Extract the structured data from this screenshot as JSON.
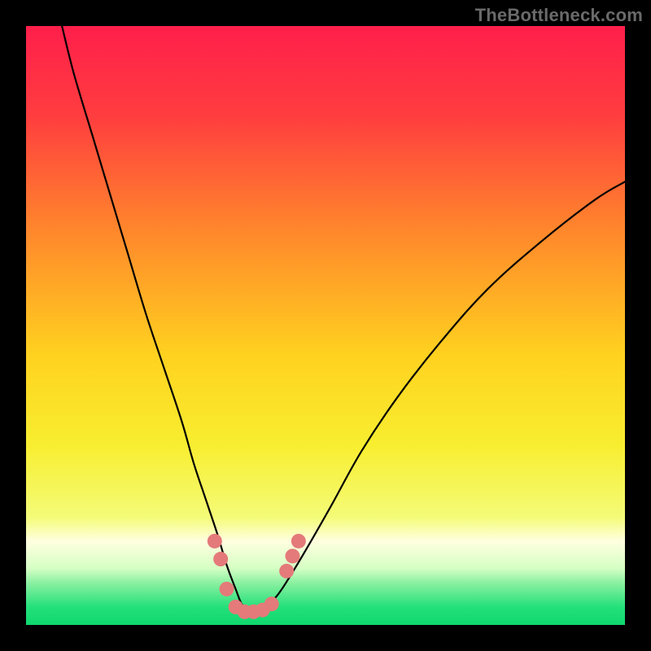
{
  "watermark": "TheBottleneck.com",
  "chart_data": {
    "type": "line",
    "title": "",
    "xlabel": "",
    "ylabel": "",
    "xlim": [
      0,
      100
    ],
    "ylim": [
      0,
      100
    ],
    "background_gradient": {
      "stops": [
        {
          "offset": 0.0,
          "color": "#ff1f4b"
        },
        {
          "offset": 0.15,
          "color": "#ff3d3f"
        },
        {
          "offset": 0.35,
          "color": "#ff8a2b"
        },
        {
          "offset": 0.55,
          "color": "#ffd21f"
        },
        {
          "offset": 0.7,
          "color": "#f8ee30"
        },
        {
          "offset": 0.82,
          "color": "#f4fb77"
        },
        {
          "offset": 0.86,
          "color": "#ffffe0"
        },
        {
          "offset": 0.905,
          "color": "#d6ffc4"
        },
        {
          "offset": 0.93,
          "color": "#8af0a0"
        },
        {
          "offset": 0.97,
          "color": "#24e07a"
        },
        {
          "offset": 1.0,
          "color": "#0fd86e"
        }
      ]
    },
    "series": [
      {
        "name": "bottleneck-curve",
        "x": [
          6,
          8,
          11,
          14,
          17,
          20,
          23,
          26,
          28,
          30,
          32,
          33.5,
          35,
          36,
          37,
          38,
          40,
          42,
          44,
          47,
          51,
          56,
          62,
          69,
          77,
          86,
          95,
          100
        ],
        "y": [
          100,
          92,
          82,
          72,
          62,
          52,
          43,
          34,
          27,
          21,
          15,
          10,
          6,
          3.5,
          2.5,
          2.5,
          3,
          5,
          8,
          13,
          20,
          29,
          38,
          47,
          56,
          64,
          71,
          74
        ]
      }
    ],
    "markers": {
      "name": "highlight-dots",
      "color": "#e47a7a",
      "radius": 9,
      "points": [
        {
          "x": 31.5,
          "y": 14
        },
        {
          "x": 32.5,
          "y": 11
        },
        {
          "x": 33.5,
          "y": 6
        },
        {
          "x": 35.0,
          "y": 3
        },
        {
          "x": 36.5,
          "y": 2.2
        },
        {
          "x": 38.0,
          "y": 2.2
        },
        {
          "x": 39.5,
          "y": 2.5
        },
        {
          "x": 41.0,
          "y": 3.5
        },
        {
          "x": 43.5,
          "y": 9
        },
        {
          "x": 44.5,
          "y": 11.5
        },
        {
          "x": 45.5,
          "y": 14
        }
      ]
    }
  }
}
